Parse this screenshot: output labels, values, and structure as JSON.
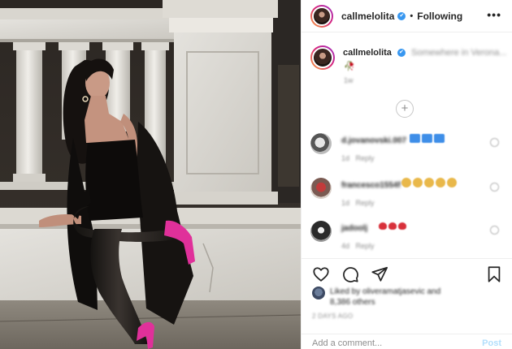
{
  "header": {
    "username": "callmelolita",
    "verified_mark": "✔",
    "separator": "•",
    "follow_status": "Following",
    "more_label": "•••"
  },
  "caption": {
    "username": "callmelolita",
    "verified_mark": "✔",
    "text": "Somewhere in Verona...",
    "emoji": "🥀",
    "time": "1w"
  },
  "load_more_label": "+",
  "comments": [
    {
      "username": "d.jovanovski.007",
      "time": "1d",
      "reply_label": "Reply",
      "emoji_style": "blue",
      "emoji_count": 3
    },
    {
      "username": "francesco1554f",
      "time": "1d",
      "reply_label": "Reply",
      "emoji_style": "gold",
      "emoji_count": 5
    },
    {
      "username": "jadoolj",
      "time": "4d",
      "reply_label": "Reply",
      "emoji_style": "red",
      "emoji_count": 3
    }
  ],
  "likes": {
    "text": "Liked by oliveramatjasevic and",
    "others": "8,386 others"
  },
  "time_ago": "2 DAYS AGO",
  "comment_input": {
    "placeholder": "Add a comment..."
  },
  "post_button": "Post",
  "colors": {
    "accent_blue": "#3897f0",
    "post_button_disabled": "#b2dffc",
    "muted_text": "#8e8e8e",
    "shoe_pink": "#e0309a"
  },
  "icons": [
    "more-options-icon",
    "verified-icon",
    "like-heart-icon",
    "comment-icon",
    "share-icon",
    "save-bookmark-icon",
    "load-more-icon",
    "comment-like-icon"
  ]
}
